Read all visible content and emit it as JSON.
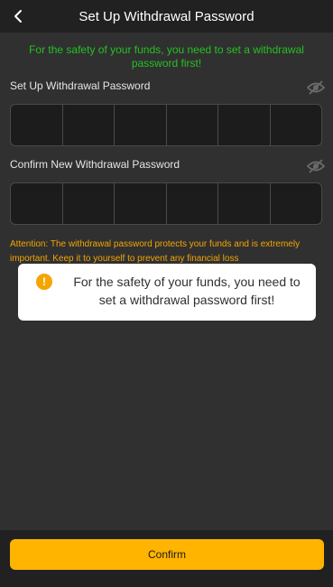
{
  "header": {
    "title": "Set Up Withdrawal Password",
    "back_icon": "chevron-left-icon"
  },
  "notice": {
    "text": "For the safety of your funds, you need to set a withdrawal password first!",
    "color": "#24c124"
  },
  "fields": [
    {
      "label": "Set Up Withdrawal Password",
      "icon": "eye-off-icon",
      "digits": 6
    },
    {
      "label": "Confirm New Withdrawal Password",
      "icon": "eye-off-icon",
      "digits": 6
    }
  ],
  "attention": {
    "text": "Attention: The withdrawal password protects your funds and is extremely important. Keep it to yourself to prevent any financial loss",
    "color": "#f5a500"
  },
  "toast": {
    "icon": "exclamation-icon",
    "icon_glyph": "!",
    "message": "For the safety of your funds, you need to set a withdrawal password first!"
  },
  "footer": {
    "confirm_label": "Confirm",
    "accent": "#ffb400"
  }
}
